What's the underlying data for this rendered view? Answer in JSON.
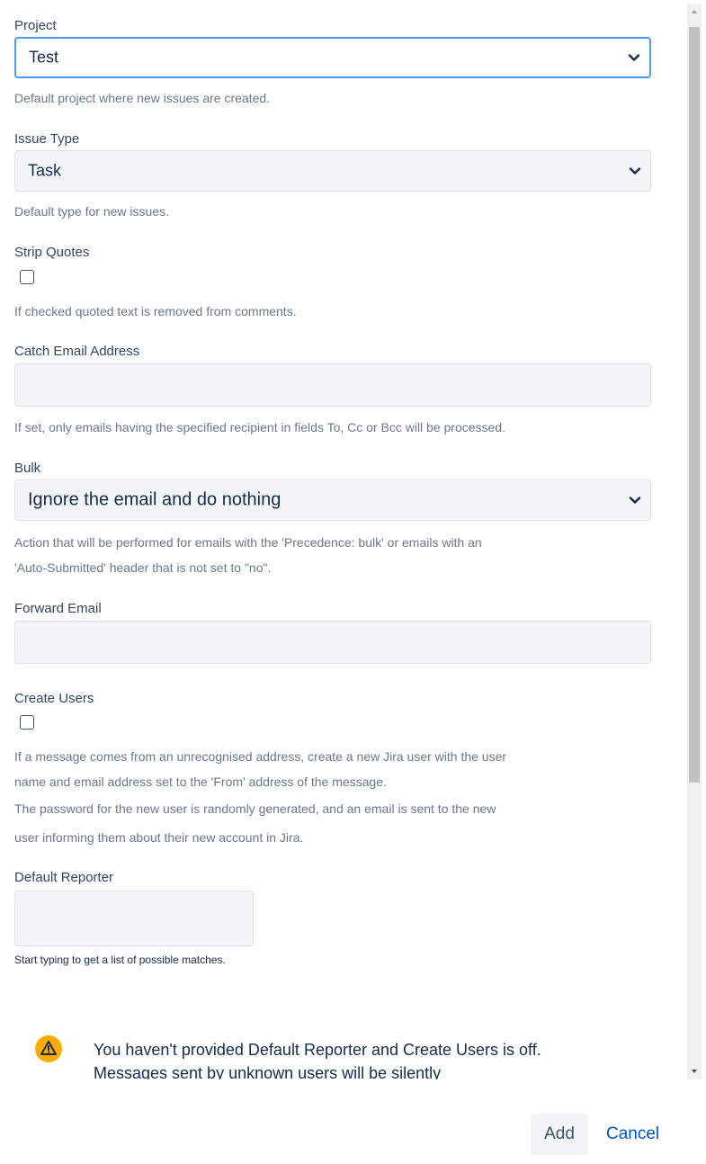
{
  "form": {
    "project": {
      "label": "Project",
      "value": "Test",
      "help": "Default project where new issues are created."
    },
    "issue_type": {
      "label": "Issue Type",
      "value": "Task",
      "help": "Default type for new issues."
    },
    "strip_quotes": {
      "label": "Strip Quotes",
      "checked": false,
      "help": "If checked quoted text is removed from comments."
    },
    "catch_email": {
      "label": "Catch Email Address",
      "value": "",
      "help": "If set, only emails having the specified recipient in fields To, Cc or Bcc will be processed."
    },
    "bulk": {
      "label": "Bulk",
      "value": "Ignore the email and do nothing",
      "help_line1": "Action that will be performed for emails with the 'Precedence: bulk' or emails with an",
      "help_line2": "'Auto-Submitted' header that is not set to \"no\"."
    },
    "forward_email": {
      "label": "Forward Email",
      "value": ""
    },
    "create_users": {
      "label": "Create Users",
      "checked": false,
      "help_line1": "If a message comes from an unrecognised address, create a new Jira user with the user",
      "help_line2": "name and email address set to the 'From' address of the message.",
      "help_line3": "The password for the new user is randomly generated, and an email is sent to the new",
      "help_line4": "user informing them about their new account in Jira."
    },
    "default_reporter": {
      "label": "Default Reporter",
      "value": "",
      "help": "Start typing to get a list of possible matches."
    },
    "warning": {
      "text": "You haven't provided Default Reporter and Create Users is off. Messages sent by unknown users will be silently",
      "icon": "warning-icon",
      "color": "#ffab00"
    }
  },
  "actions": {
    "add_label": "Add",
    "cancel_label": "Cancel"
  },
  "colors": {
    "focus_border": "#4c9aff",
    "link": "#0052cc",
    "field_bg": "#f4f5f7"
  }
}
